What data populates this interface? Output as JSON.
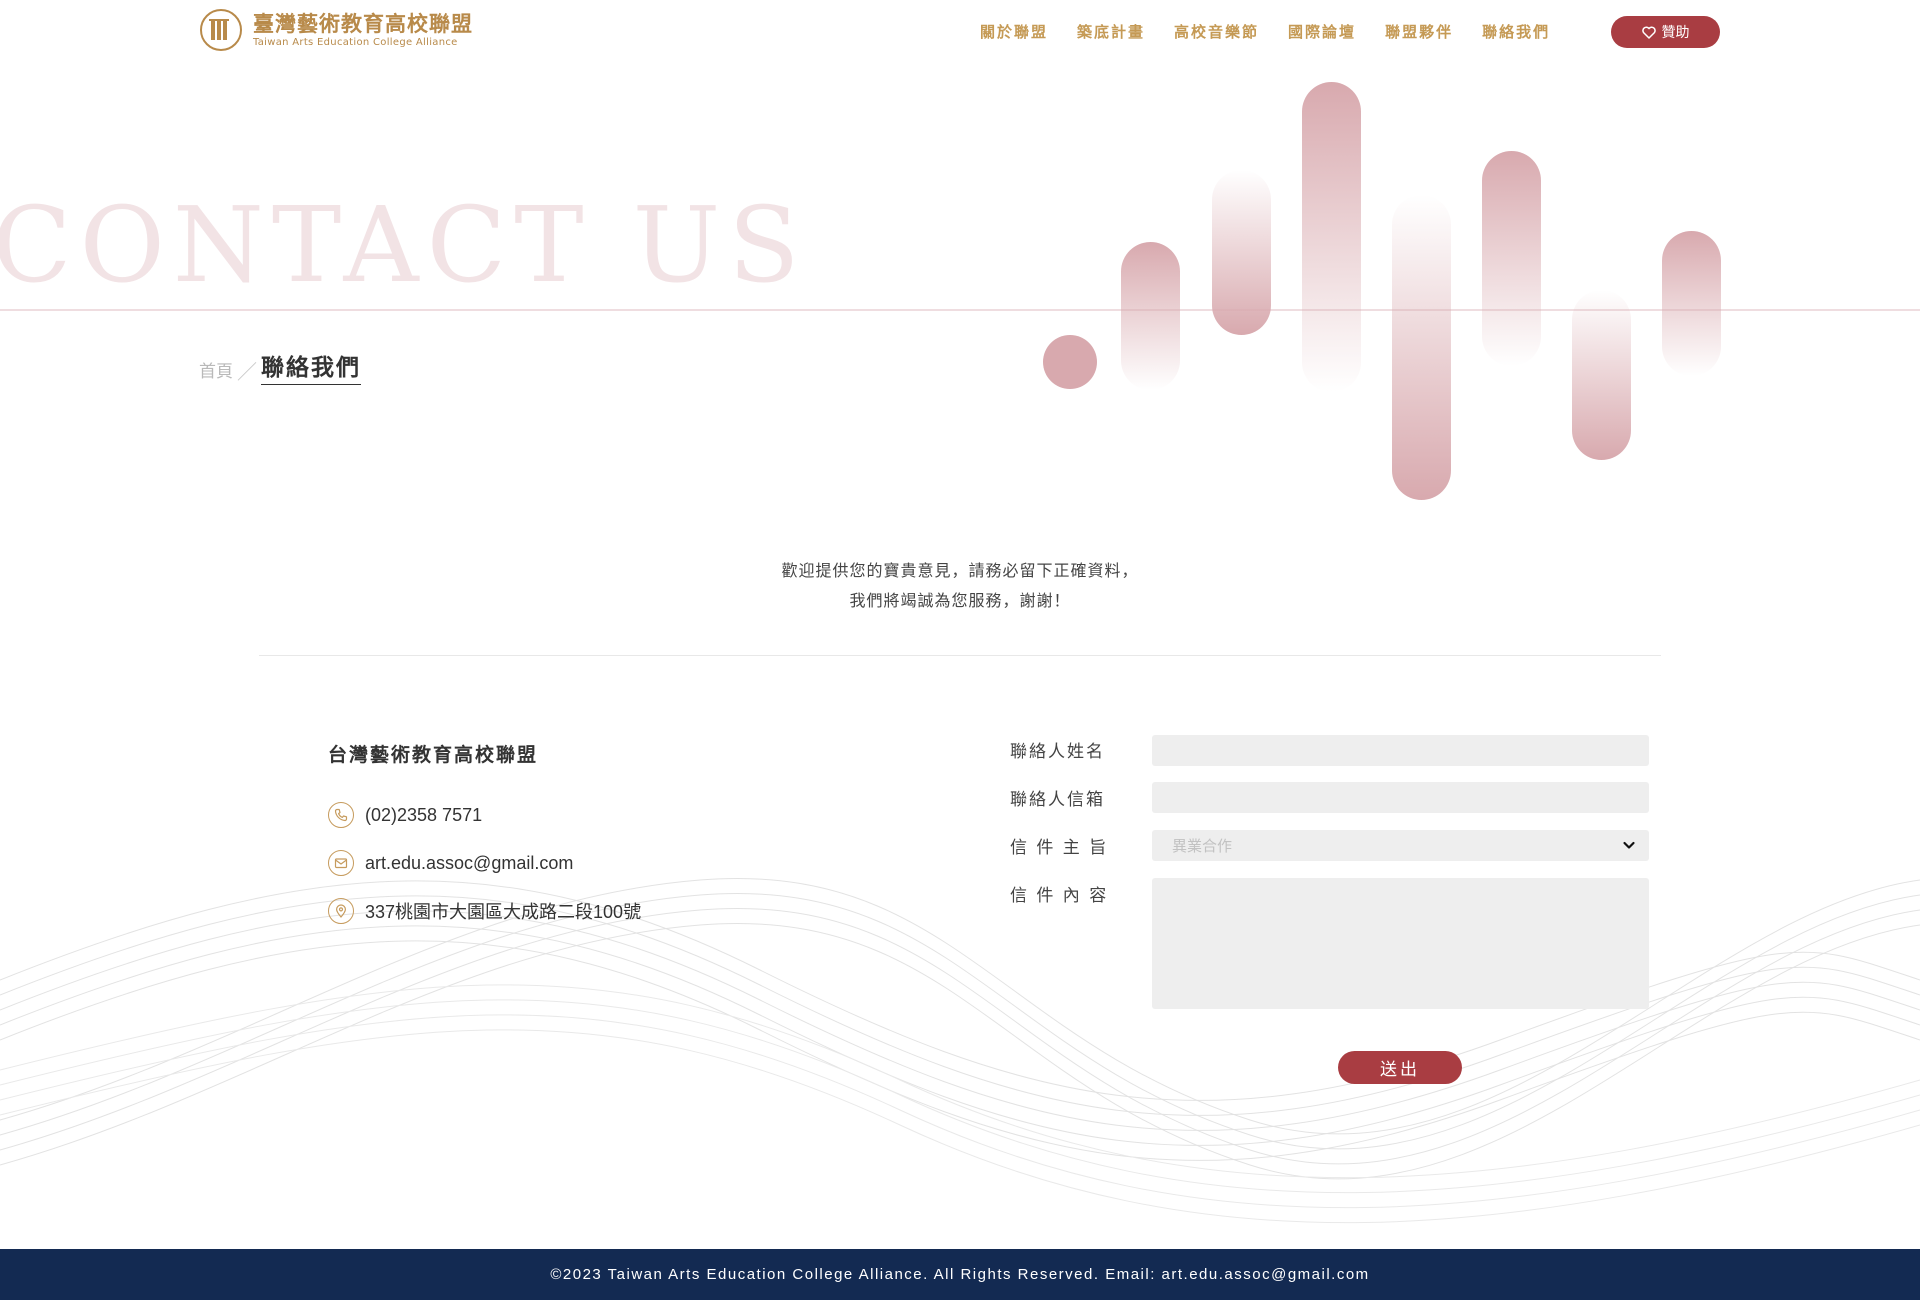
{
  "header": {
    "logo": {
      "name_cn": "臺灣藝術教育高校聯盟",
      "name_en": "Taiwan Arts Education College Alliance"
    },
    "nav": [
      {
        "label": "關於聯盟"
      },
      {
        "label": "築底計畫"
      },
      {
        "label": "高校音樂節"
      },
      {
        "label": "國際論壇"
      },
      {
        "label": "聯盟夥伴"
      },
      {
        "label": "聯絡我們"
      }
    ],
    "sponsor_label": "贊助"
  },
  "hero": {
    "title": "CONTACT US",
    "breadcrumb": {
      "home": "首頁",
      "separator": "／",
      "current": "聯絡我們"
    }
  },
  "intro": {
    "line1": "歡迎提供您的寶貴意見，請務必留下正確資料，",
    "line2": "我們將竭誠為您服務，謝謝！"
  },
  "contact": {
    "org_name": "台灣藝術教育高校聯盟",
    "phone": "(02)2358 7571",
    "email": "art.edu.assoc@gmail.com",
    "address": "337桃園市大園區大成路二段100號"
  },
  "form": {
    "name_label": "聯絡人姓名",
    "email_label": "聯絡人信箱",
    "subject_label": "信 件 主 旨",
    "subject_value": "異業合作",
    "message_label": "信 件 內 容",
    "submit_label": "送出"
  },
  "footer": {
    "text": "©2023 Taiwan Arts Education College Alliance. All Rights Reserved. Email: art.edu.assoc@gmail.com"
  },
  "colors": {
    "brand_gold": "#c59a55",
    "accent_red": "#a93d42",
    "footer_navy": "#132a52",
    "bar_pink": "#d8a9ae"
  },
  "icons": [
    "logo-mark-icon",
    "heart-icon",
    "phone-icon",
    "mail-icon",
    "location-pin-icon",
    "chevron-down-icon"
  ]
}
